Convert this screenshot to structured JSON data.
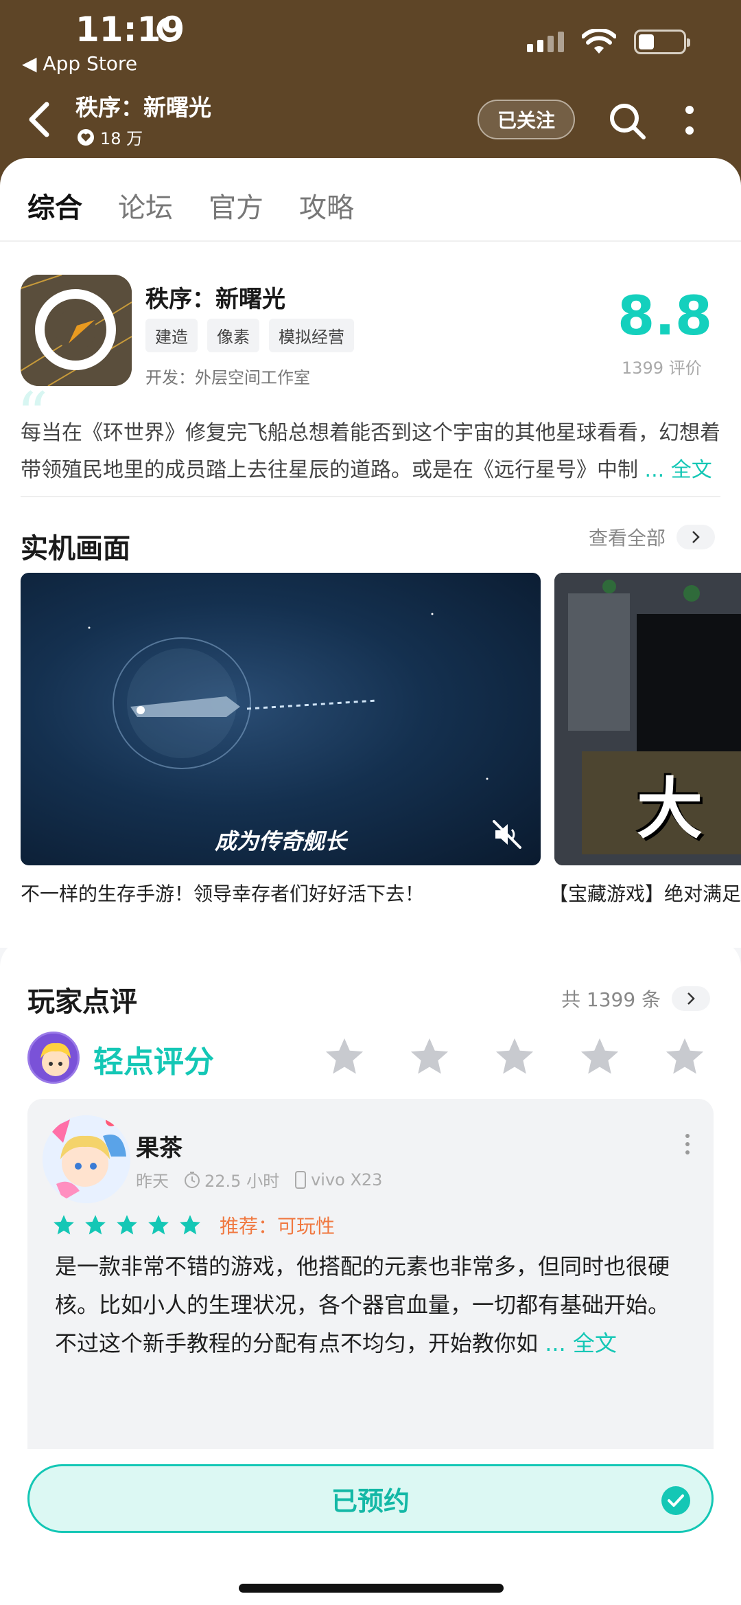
{
  "status_bar": {
    "time": "11:19",
    "back_app": "App Store"
  },
  "header": {
    "title": "秩序：新曙光",
    "likes": "18 万",
    "follow_label": "已关注"
  },
  "tabs": [
    {
      "label": "综合",
      "active": true
    },
    {
      "label": "论坛",
      "active": false
    },
    {
      "label": "官方",
      "active": false
    },
    {
      "label": "攻略",
      "active": false
    }
  ],
  "app": {
    "name": "秩序：新曙光",
    "tags": [
      "建造",
      "像素",
      "模拟经营"
    ],
    "developer": "开发：外层空间工作室",
    "score": "8.8",
    "rating_count": "1399 评价",
    "description": "每当在《环世界》修复完飞船总想着能否到这个宇宙的其他星球看看，幻想着带领殖民地里的成员踏上去往星辰的道路。或是在《远行星号》中制",
    "more_label": "... 全文"
  },
  "screenshots": {
    "title": "实机画面",
    "view_all": "查看全部",
    "items": [
      {
        "caption": "成为传奇舰长",
        "description": "不一样的生存手游！领导幸存者们好好活下去！"
      },
      {
        "caption": "大世",
        "description": "【宝藏游戏】绝对满足"
      }
    ]
  },
  "reviews": {
    "title": "玩家点评",
    "total": "共 1399 条",
    "rate_prompt": "轻点评分",
    "card": {
      "name": "果茶",
      "time": "昨天",
      "playtime": "22.5 小时",
      "device": "vivo X23",
      "stars": 5,
      "recommend": "推荐：可玩性",
      "text": "是一款非常不错的游戏，他搭配的元素也非常多，但同时也很硬核。比如小人的生理状况，各个器官血量，一切都有基础开始。",
      "text2": "不过这个新手教程的分配有点不均匀，开始教你如",
      "more_label": "... 全文"
    }
  },
  "bottom": {
    "reserve_label": "已预约"
  },
  "colors": {
    "accent": "#14c7b5",
    "header_bg": "#5e4527",
    "recommend": "#f07840"
  }
}
